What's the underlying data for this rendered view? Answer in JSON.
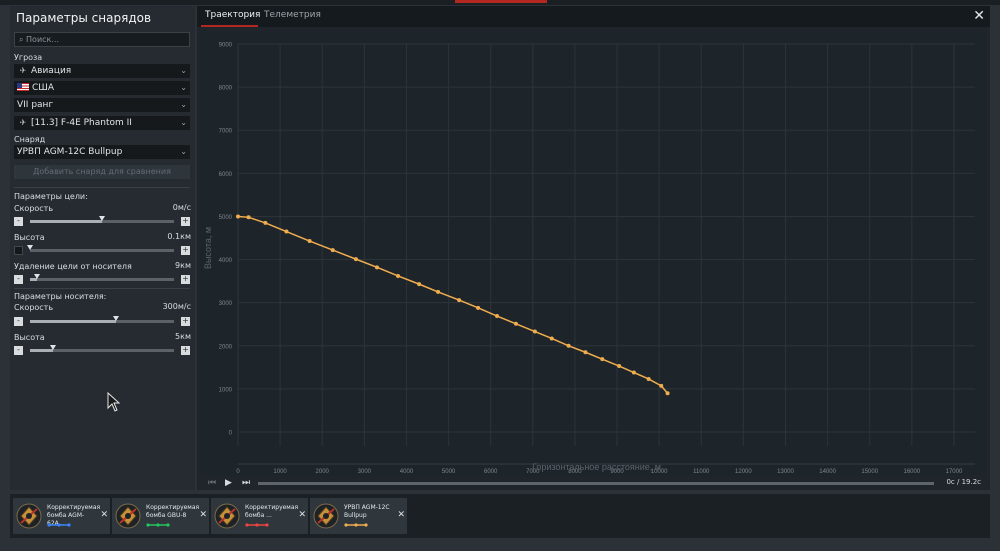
{
  "window": {
    "title": "Параметры снарядов"
  },
  "search": {
    "placeholder": "Поиск..."
  },
  "threat": {
    "label": "Угроза",
    "type": "Авиация",
    "country": "США",
    "rank": "VII ранг",
    "vehicle": "[11.3] F-4E Phantom II"
  },
  "shell": {
    "label": "Снаряд",
    "value": "УРВП AGM-12C Bullpup",
    "add_label": "Добавить снаряд для сравнения"
  },
  "target": {
    "section_label": "Параметры цели:",
    "speed_label": "Скорость",
    "speed_value": "0м/с",
    "speed_level": 0.5,
    "altitude_label": "Высота",
    "altitude_value": "0.1км",
    "altitude_level": 0.0,
    "distance_label": "Удаление цели от носителя",
    "distance_value": "9км",
    "distance_level": 0.05
  },
  "carrier": {
    "section_label": "Параметры носителя:",
    "speed_label": "Скорость",
    "speed_value": "300м/с",
    "speed_level": 0.6,
    "altitude_label": "Высота",
    "altitude_value": "5км",
    "altitude_level": 0.16
  },
  "tabs": [
    {
      "label": "Траектория",
      "active": true
    },
    {
      "label": "Телеметрия",
      "active": false
    }
  ],
  "player": {
    "time": "0с / 19.2с",
    "progress": 0
  },
  "chart_data": {
    "type": "line",
    "xlabel": "Горизонтальное расстояние, м",
    "ylabel": "Высота, м",
    "xlim": [
      0,
      17500
    ],
    "ylim": [
      0,
      9000
    ],
    "x_ticks": [
      0,
      1000,
      2000,
      3000,
      4000,
      5000,
      6000,
      7000,
      8000,
      9000,
      10000,
      11000,
      12000,
      13000,
      14000,
      15000,
      16000,
      17000
    ],
    "y_ticks": [
      0,
      1000,
      2000,
      3000,
      4000,
      5000,
      6000,
      7000,
      8000,
      9000
    ],
    "grid": true,
    "series": [
      {
        "color": "#f0ad4e",
        "x": [
          0,
          250,
          650,
          1150,
          1700,
          2250,
          2800,
          3300,
          3800,
          4300,
          4750,
          5250,
          5700,
          6150,
          6600,
          7050,
          7450,
          7850,
          8250,
          8650,
          9050,
          9400,
          9750,
          10050,
          10200
        ],
        "y": [
          5000,
          4980,
          4850,
          4650,
          4430,
          4220,
          4010,
          3820,
          3620,
          3430,
          3250,
          3060,
          2880,
          2690,
          2510,
          2330,
          2170,
          2000,
          1850,
          1690,
          1530,
          1380,
          1230,
          1070,
          900
        ]
      }
    ]
  },
  "compare_list": [
    {
      "name": "Корректируемая бомба AGM-62A...",
      "color": "#3b82f6"
    },
    {
      "name": "Корректируемая бомба GBU-8",
      "color": "#22c55e"
    },
    {
      "name": "Корректируемая бомба ...",
      "color": "#ef4444"
    },
    {
      "name": "УРВП AGM-12C Bullpup",
      "color": "#f0ad4e"
    }
  ],
  "icons": [
    "search-icon",
    "chevron-down-icon",
    "plane-icon",
    "us-flag-icon",
    "jet-icon",
    "close-icon",
    "skip-back-icon",
    "play-icon",
    "skip-forward-icon",
    "emblem-icon",
    "mouse-cursor-icon"
  ]
}
